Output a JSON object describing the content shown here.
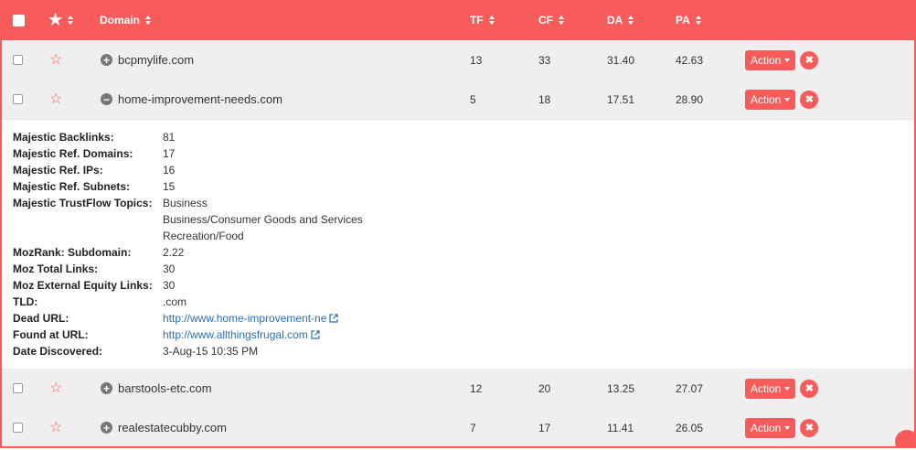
{
  "header": {
    "domain": "Domain",
    "tf": "TF",
    "cf": "CF",
    "da": "DA",
    "pa": "PA"
  },
  "rows": [
    {
      "domain": "bcpmylife.com",
      "tf": "13",
      "cf": "33",
      "da": "31.40",
      "pa": "42.63",
      "expanded": false
    },
    {
      "domain": "home-improvement-needs.com",
      "tf": "5",
      "cf": "18",
      "da": "17.51",
      "pa": "28.90",
      "expanded": true
    },
    {
      "domain": "barstools-etc.com",
      "tf": "12",
      "cf": "20",
      "da": "13.25",
      "pa": "27.07",
      "expanded": false
    },
    {
      "domain": "realestatecubby.com",
      "tf": "7",
      "cf": "17",
      "da": "11.41",
      "pa": "26.05",
      "expanded": false
    }
  ],
  "action_label": "Action",
  "details": {
    "backlinks": {
      "label": "Majestic Backlinks:",
      "value": "81"
    },
    "ref_domains": {
      "label": "Majestic Ref. Domains:",
      "value": "17"
    },
    "ref_ips": {
      "label": "Majestic Ref. IPs:",
      "value": "16"
    },
    "ref_subnets": {
      "label": "Majestic Ref. Subnets:",
      "value": "15"
    },
    "topics": {
      "label": "Majestic TrustFlow Topics:",
      "values": [
        "Business",
        "Business/Consumer Goods and Services",
        "Recreation/Food"
      ]
    },
    "mozrank": {
      "label": "MozRank: Subdomain:",
      "value": "2.22"
    },
    "moz_total": {
      "label": "Moz Total Links:",
      "value": "30"
    },
    "moz_external": {
      "label": "Moz External Equity Links:",
      "value": "30"
    },
    "tld": {
      "label": "TLD:",
      "value": ".com"
    },
    "dead_url": {
      "label": "Dead URL:",
      "value": "http://www.home-improvement-ne"
    },
    "found_url": {
      "label": "Found at URL:",
      "value": "http://www.allthingsfrugal.com"
    },
    "date": {
      "label": "Date Discovered:",
      "value": "3-Aug-15 10:35 PM"
    }
  },
  "colors": {
    "accent": "#f75c5b",
    "link": "#2a6fb5",
    "row_bg": "#efefef"
  }
}
